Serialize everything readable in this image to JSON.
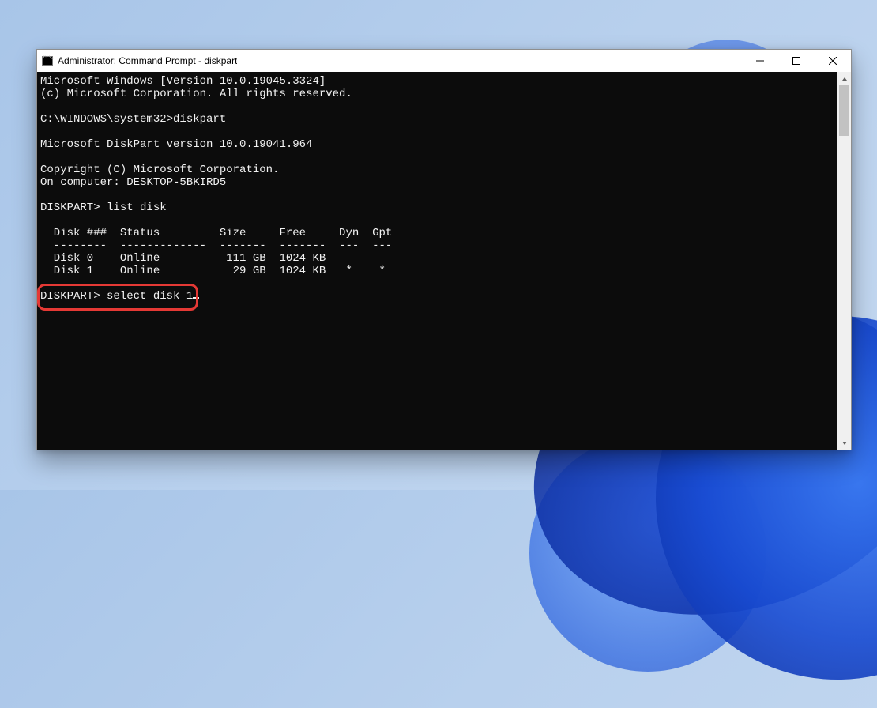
{
  "window": {
    "title": "Administrator: Command Prompt - diskpart",
    "icon_name": "cmd-icon"
  },
  "controls": {
    "minimize_title": "Minimize",
    "maximize_title": "Maximize",
    "close_title": "Close"
  },
  "terminal": {
    "lines": [
      "Microsoft Windows [Version 10.0.19045.3324]",
      "(c) Microsoft Corporation. All rights reserved.",
      "",
      "C:\\WINDOWS\\system32>diskpart",
      "",
      "Microsoft DiskPart version 10.0.19041.964",
      "",
      "Copyright (C) Microsoft Corporation.",
      "On computer: DESKTOP-5BKIRD5",
      "",
      "DISKPART> list disk",
      "",
      "  Disk ###  Status         Size     Free     Dyn  Gpt",
      "  --------  -------------  -------  -------  ---  ---",
      "  Disk 0    Online          111 GB  1024 KB",
      "  Disk 1    Online           29 GB  1024 KB   *    *",
      "",
      "DISKPART> select disk 1"
    ],
    "table": {
      "headers": [
        "Disk ###",
        "Status",
        "Size",
        "Free",
        "Dyn",
        "Gpt"
      ],
      "rows": [
        {
          "disk": "Disk 0",
          "status": "Online",
          "size": "111 GB",
          "free": "1024 KB",
          "dyn": "",
          "gpt": ""
        },
        {
          "disk": "Disk 1",
          "status": "Online",
          "size": "29 GB",
          "free": "1024 KB",
          "dyn": "*",
          "gpt": "*"
        }
      ]
    },
    "prompts": {
      "shell_prompt": "C:\\WINDOWS\\system32>",
      "diskpart_prompt": "DISKPART>",
      "last_command": "select disk 1"
    }
  },
  "highlight": {
    "target": "select disk 1",
    "color": "#e53935"
  }
}
